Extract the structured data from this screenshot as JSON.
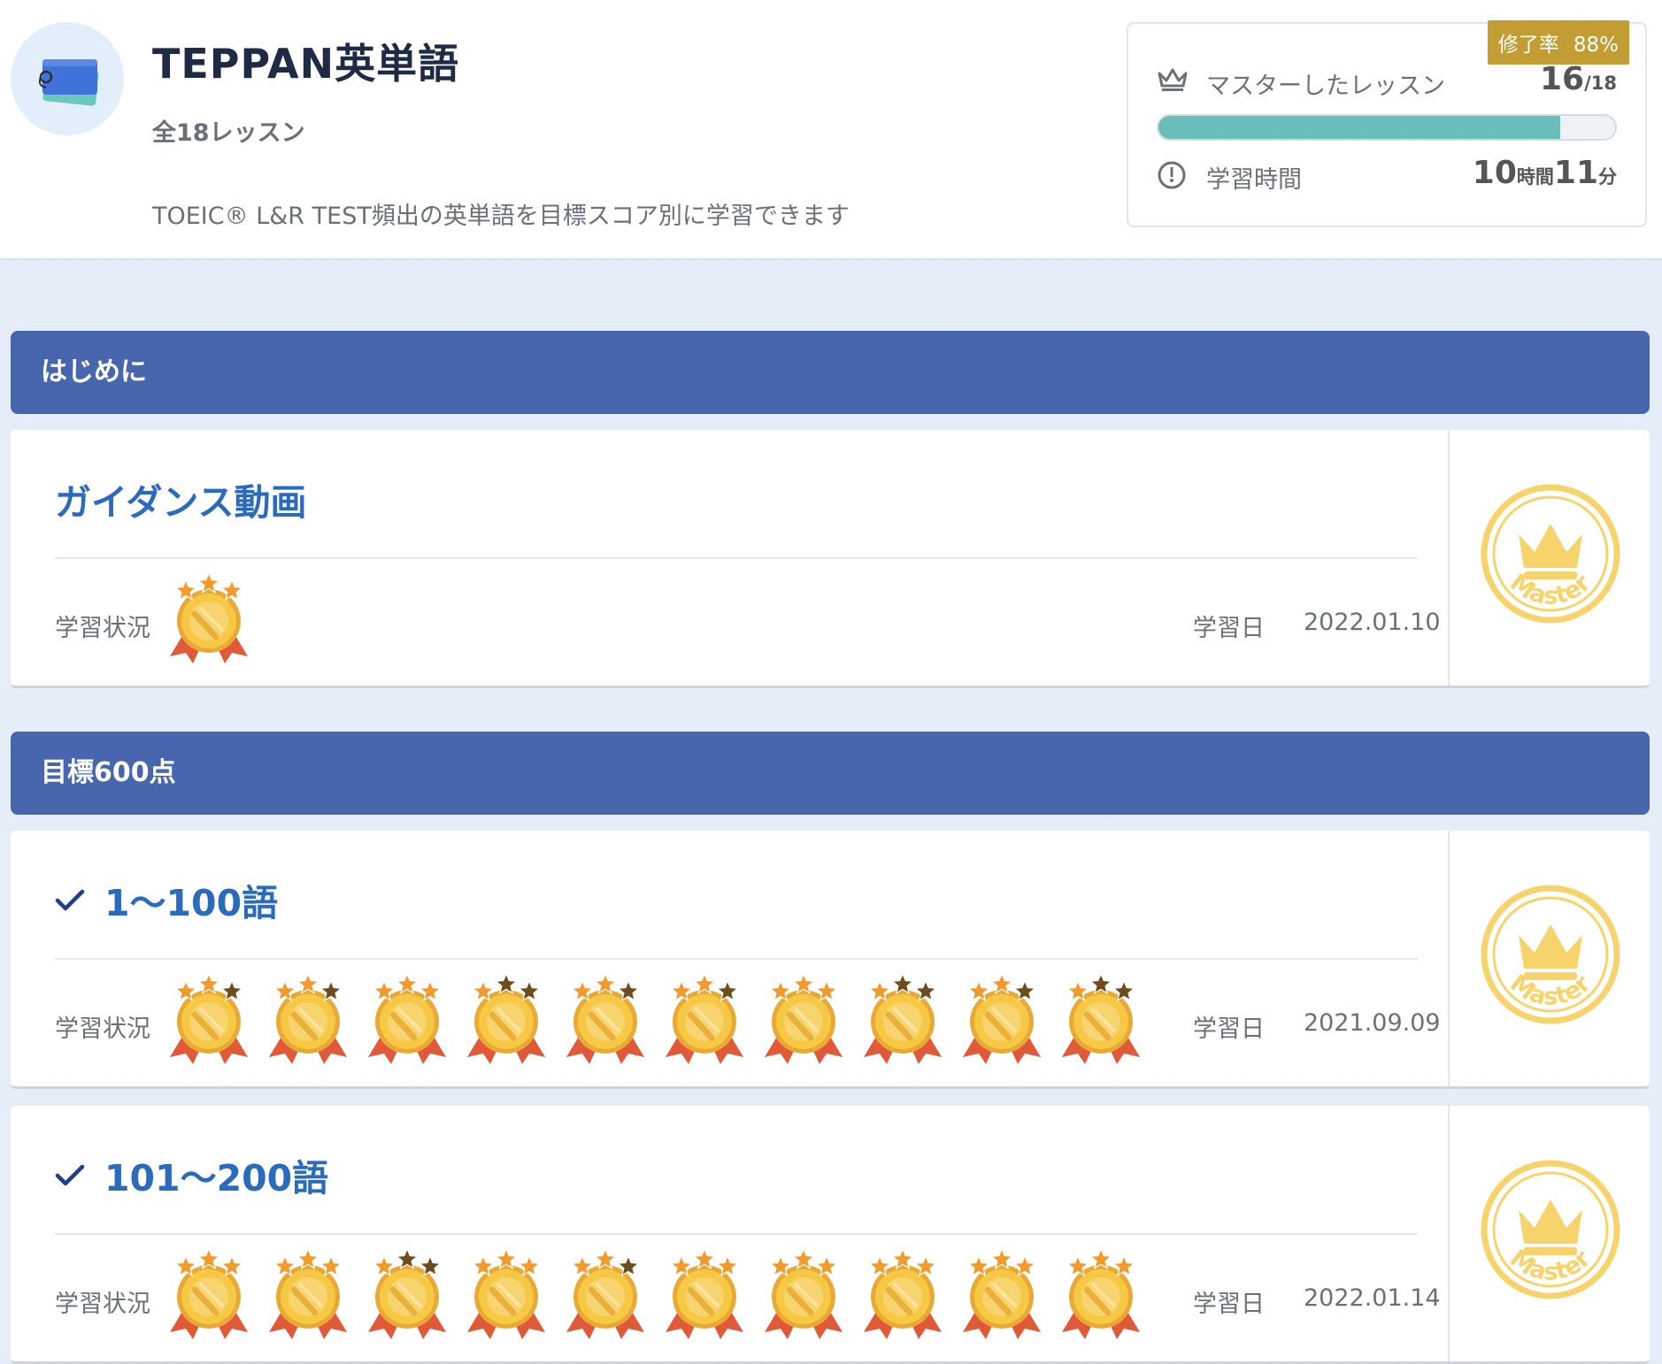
{
  "course": {
    "title": "TEPPAN英単語",
    "lesson_count": "全18レッスン",
    "description": "TOEIC® L&R TEST頻出の英単語を目標スコア別に学習できます"
  },
  "progress": {
    "completion_label": "修了率",
    "completion_value": "88%",
    "mastered_label": "マスターしたレッスン",
    "mastered_count": "16",
    "mastered_total": "/18",
    "mastered_fraction": 0.88,
    "time_label": "学習時間",
    "time_hours": "10",
    "time_hours_unit": "時間",
    "time_minutes": "11",
    "time_minutes_unit": "分"
  },
  "sections": [
    {
      "title": "はじめに",
      "lessons": [
        {
          "title": "ガイダンス動画",
          "checked": false,
          "status_label": "学習状況",
          "date_label": "学習日",
          "date": "2022.01.10",
          "medal_stars": [
            3
          ],
          "master_text": "Master"
        }
      ]
    },
    {
      "title": "目標600点",
      "lessons": [
        {
          "title": "1〜100語",
          "checked": true,
          "status_label": "学習状況",
          "date_label": "学習日",
          "date": "2021.09.09",
          "medal_stars": [
            2,
            2,
            3,
            1,
            2,
            2,
            3,
            1,
            2,
            1
          ],
          "master_text": "Master"
        },
        {
          "title": "101〜200語",
          "checked": true,
          "status_label": "学習状況",
          "date_label": "学習日",
          "date": "2022.01.14",
          "medal_stars": [
            3,
            3,
            1,
            3,
            2,
            3,
            3,
            3,
            3,
            3
          ],
          "master_text": "Master"
        }
      ]
    }
  ],
  "colors": {
    "section_bar": "#4766ae",
    "lesson_title": "#2a6bbe",
    "progress_fill": "#6bbdb9",
    "badge": "#c29d33",
    "medal_gold": "#f6c844",
    "star_orange": "#f39a2c",
    "star_brown": "#6e4c1e",
    "master_gold": "#f6d46b"
  },
  "icons": {
    "course": "flashcards-icon",
    "mastered": "crown-icon",
    "time": "clock-icon",
    "check": "check-icon",
    "medal": "medal-icon",
    "master": "master-crown-badge"
  }
}
